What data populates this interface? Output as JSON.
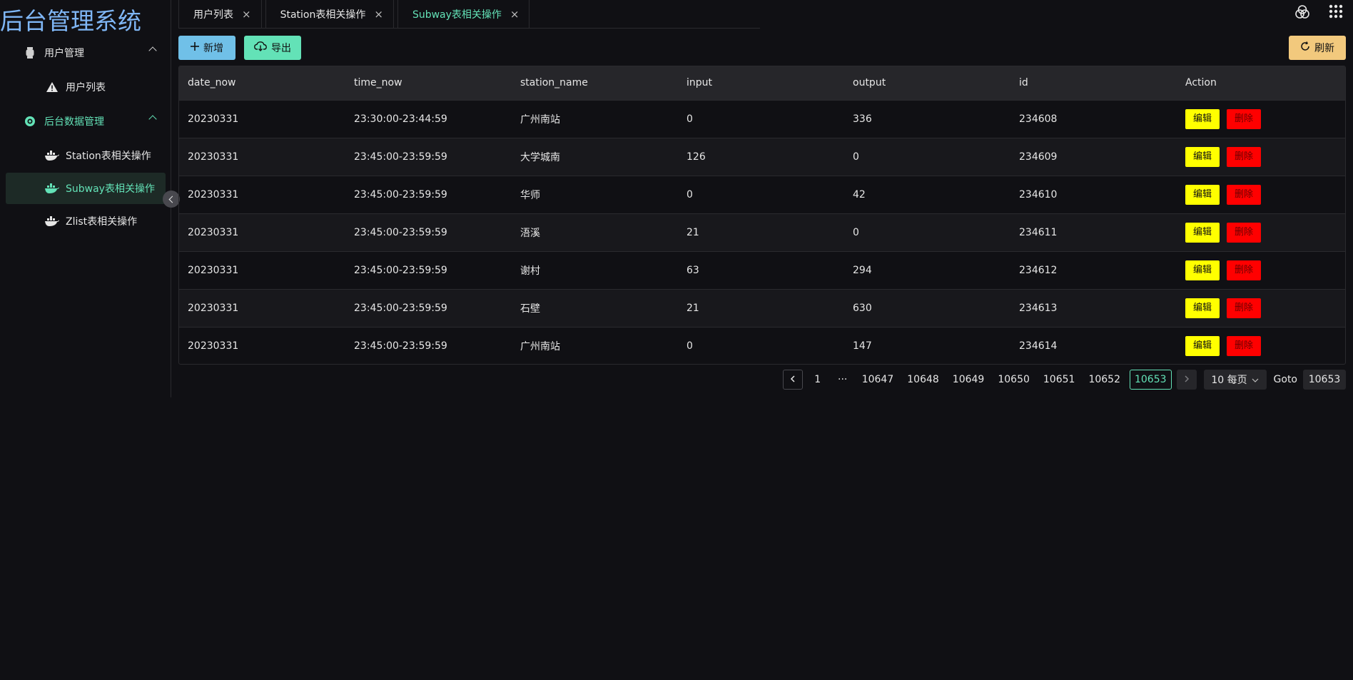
{
  "app": {
    "title": "后台管理系统"
  },
  "sidebar": {
    "groups": [
      {
        "label": "用户管理",
        "icon": "watch-icon",
        "items": [
          {
            "label": "用户列表",
            "icon": "warning-icon"
          }
        ]
      },
      {
        "label": "后台数据管理",
        "icon": "eye-icon",
        "items": [
          {
            "label": "Station表相关操作",
            "icon": "docker-icon"
          },
          {
            "label": "Subway表相关操作",
            "icon": "docker-icon"
          },
          {
            "label": "Zlist表相关操作",
            "icon": "docker-icon"
          }
        ]
      }
    ]
  },
  "tabs": [
    {
      "label": "用户列表",
      "close": "×"
    },
    {
      "label": "Station表相关操作",
      "close": "×"
    },
    {
      "label": "Subway表相关操作",
      "close": "×"
    }
  ],
  "toolbar": {
    "add_label": "新增",
    "export_label": "导出",
    "refresh_label": "刷新"
  },
  "table": {
    "columns": [
      "date_now",
      "time_now",
      "station_name",
      "input",
      "output",
      "id",
      "Action"
    ],
    "rows": [
      [
        "20230331",
        "23:30:00-23:44:59",
        "广州南站",
        "0",
        "336",
        "234608"
      ],
      [
        "20230331",
        "23:45:00-23:59:59",
        "大学城南",
        "126",
        "0",
        "234609"
      ],
      [
        "20230331",
        "23:45:00-23:59:59",
        "华师",
        "0",
        "42",
        "234610"
      ],
      [
        "20230331",
        "23:45:00-23:59:59",
        "浯溪",
        "21",
        "0",
        "234611"
      ],
      [
        "20230331",
        "23:45:00-23:59:59",
        "谢村",
        "63",
        "294",
        "234612"
      ],
      [
        "20230331",
        "23:45:00-23:59:59",
        "石壁",
        "21",
        "630",
        "234613"
      ],
      [
        "20230331",
        "23:45:00-23:59:59",
        "广州南站",
        "0",
        "147",
        "234614"
      ]
    ],
    "edit_label": "编辑",
    "delete_label": "删除"
  },
  "pagination": {
    "pages": [
      "1",
      "···",
      "10647",
      "10648",
      "10649",
      "10650",
      "10651",
      "10652",
      "10653"
    ],
    "current": "10653",
    "page_size": "10 每页",
    "goto_label": "Goto",
    "goto_value": "10653"
  },
  "colors": {
    "accent": "#63e2b7",
    "info": "#70c0e8",
    "warning": "#f2c97d",
    "title": "#7fb6f5"
  }
}
